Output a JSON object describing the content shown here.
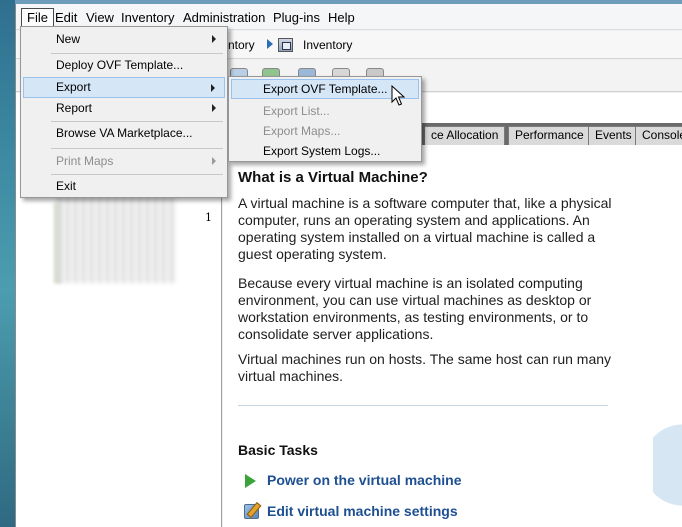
{
  "menubar": {
    "items": [
      "File",
      "Edit",
      "View",
      "Inventory",
      "Administration",
      "Plug-ins",
      "Help"
    ]
  },
  "breadcrumb": {
    "partial": "ntory",
    "current": "Inventory"
  },
  "left_panel": {
    "count": "1"
  },
  "tabs": [
    "ce Allocation",
    "Performance",
    "Events",
    "Console"
  ],
  "content": {
    "title": "What is a Virtual Machine?",
    "paragraphs": [
      "A virtual machine is a software computer that, like a physical computer, runs an operating system and applications. An operating system installed on a virtual machine is called a guest operating system.",
      "Because every virtual machine is an isolated computing environment, you can use virtual machines as desktop or workstation environments, as testing environments, or to consolidate server applications.",
      "Virtual machines run on hosts. The same host can run many virtual machines."
    ],
    "basic_tasks_title": "Basic Tasks",
    "tasks": [
      "Power on the virtual machine",
      "Edit virtual machine settings"
    ]
  },
  "file_menu": {
    "items": [
      {
        "label": "New",
        "submenu": true,
        "disabled": false
      },
      {
        "label": "Deploy OVF Template...",
        "submenu": false,
        "disabled": false
      },
      {
        "label": "Export",
        "submenu": true,
        "disabled": false,
        "highlighted": true
      },
      {
        "label": "Report",
        "submenu": true,
        "disabled": false
      },
      {
        "label": "Browse VA Marketplace...",
        "submenu": false,
        "disabled": false
      },
      {
        "label": "Print Maps",
        "submenu": true,
        "disabled": true
      },
      {
        "label": "Exit",
        "submenu": false,
        "disabled": false
      }
    ]
  },
  "export_menu": {
    "items": [
      {
        "label": "Export OVF Template...",
        "disabled": false,
        "highlighted": true
      },
      {
        "label": "Export List...",
        "disabled": true
      },
      {
        "label": "Export Maps...",
        "disabled": true
      },
      {
        "label": "Export System Logs...",
        "disabled": false
      }
    ]
  },
  "colors": {
    "highlight_bg": "#d5e6f7",
    "highlight_border": "#9ac2ec",
    "link": "#1d4f91",
    "disabled_text": "#8d8d8d",
    "tab_strip": "#6a6a6a"
  },
  "icons": {
    "inventory": "inventory-icon",
    "power_on": "play-icon",
    "edit_settings": "edit-settings-icon"
  }
}
